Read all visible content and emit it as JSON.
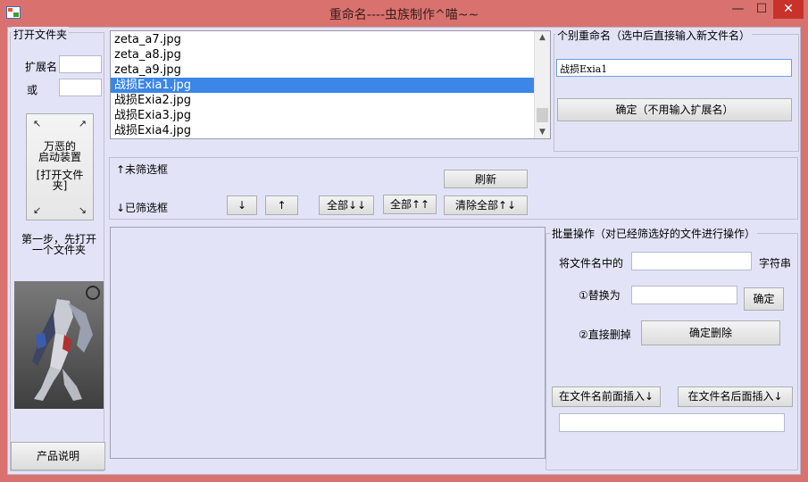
{
  "window": {
    "title": "重命名----虫族制作^喵~~",
    "min": "—",
    "max": "☐",
    "close": "✕"
  },
  "left": {
    "group_title": "打开文件夹",
    "ext_label": "扩展名",
    "or_label": "或",
    "ext_value": "",
    "or_value": "",
    "big_button": {
      "line1": "万恶的",
      "line2": "启动装置",
      "line3": "[打开文件",
      "line4": "夹]"
    },
    "step_text": "第一步，先打开一个文件夹",
    "product_button": "产品说明"
  },
  "file_list": {
    "items": [
      "zeta_a7.jpg",
      "zeta_a8.jpg",
      "zeta_a9.jpg",
      "战损Exia1.jpg",
      "战损Exia2.jpg",
      "战损Exia3.jpg",
      "战损Exia4.jpg"
    ],
    "selected_index": 3
  },
  "rename_single": {
    "group_title": "个别重命名（选中后直接输入新文件名）",
    "input_value": "战损Exia1",
    "confirm_button": "确定（不用输入扩展名）"
  },
  "filter": {
    "unfiltered_label": "↑未筛选框",
    "filtered_label": "↓已筛选框",
    "refresh_button": "刷新",
    "down_button": "↓",
    "up_button": "↑",
    "all_down_button": "全部↓↓",
    "all_up_button": "全部↑↑",
    "clear_all_button": "清除全部↑↓"
  },
  "batch": {
    "group_title": "批量操作（对已经筛选好的文件进行操作）",
    "prefix_label": "将文件名中的",
    "suffix_label": "字符串",
    "find_value": "",
    "replace_label": "①替换为",
    "replace_value": "",
    "replace_confirm": "确定",
    "delete_label": "②直接删掉",
    "delete_confirm": "确定删除",
    "insert_front_button": "在文件名前面插入↓",
    "insert_back_button": "在文件名后面插入↓",
    "insert_value": ""
  }
}
